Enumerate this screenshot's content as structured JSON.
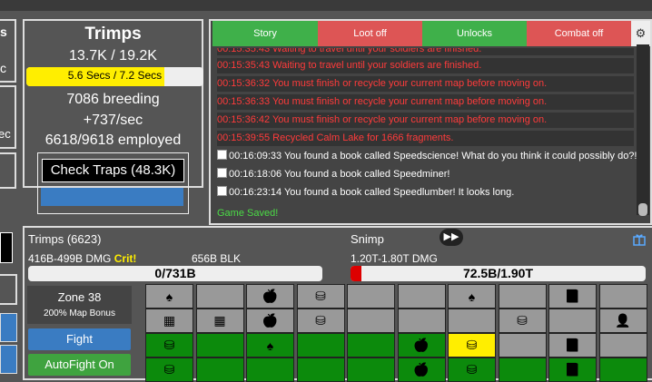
{
  "left_partial": {
    "text1": "s",
    "text2": "c",
    "text3": "ec"
  },
  "trimps_panel": {
    "title": "Trimps",
    "population": "13.7K / 19.2K",
    "breed_timer": "5.6 Secs / 7.2 Secs",
    "breed_progress": 0.78,
    "breeding": "7086 breeding",
    "rate": "+737/sec",
    "employed": "6618/9618 employed",
    "check_traps": "Check Traps (48.3K)"
  },
  "log": {
    "tabs": [
      {
        "label": "Story",
        "color": "#3fb04a"
      },
      {
        "label": "Loot off",
        "color": "#dd5555"
      },
      {
        "label": "Unlocks",
        "color": "#3fb04a"
      },
      {
        "label": "Combat off",
        "color": "#dd5555"
      }
    ],
    "lines": [
      {
        "text": "00:15:35:43 Waiting to travel until your soldiers are finished.",
        "style": "red",
        "clipped": true
      },
      {
        "text": "00:15:35:43 Waiting to travel until your soldiers are finished.",
        "style": "red"
      },
      {
        "text": "00:15:36:32 You must finish or recycle your current map before moving on.",
        "style": "red"
      },
      {
        "text": "00:15:36:33 You must finish or recycle your current map before moving on.",
        "style": "red"
      },
      {
        "text": "00:15:36:42 You must finish or recycle your current map before moving on.",
        "style": "red"
      },
      {
        "text": "00:15:39:55 Recycled Calm Lake for 1666 fragments.",
        "style": "red"
      },
      {
        "text": "00:16:09:33 You found a book called Speedscience! What do you think it could possibly do?!",
        "style": "white"
      },
      {
        "text": "00:16:18:06 You found a book called Speedminer!",
        "style": "white"
      },
      {
        "text": "00:16:23:14 You found a book called Speedlumber! It looks long.",
        "style": "white"
      },
      {
        "text": "Game Saved!",
        "style": "green"
      }
    ]
  },
  "battle": {
    "trimps_label": "Trimps (6623)",
    "dmg": "416B-499B DMG",
    "crit": "Crit!",
    "blk": "656B BLK",
    "trimp_hp": "0/731B",
    "trimp_hp_fraction": 0.0,
    "enemy_label": "Snimp",
    "enemy_dmg": "1.20T-1.80T DMG",
    "enemy_hp": "72.5B/1.90T",
    "enemy_hp_fraction": 0.038
  },
  "zone": {
    "name": "Zone 38",
    "bonus": "200% Map Bonus",
    "fight": "Fight",
    "autofight": "AutoFight On"
  },
  "grid": {
    "rows": [
      [
        "spade",
        "",
        "apple",
        "coins",
        "",
        "",
        "spade",
        "",
        "book"
      ],
      [
        "grid",
        "grid",
        "apple",
        "coins",
        "",
        "",
        "",
        "coins",
        "",
        "person"
      ],
      [
        "coins",
        "",
        "spade",
        "",
        "",
        "apple",
        "coins",
        "",
        "book"
      ],
      [
        "coins",
        "",
        "",
        "",
        "",
        "apple",
        "coins",
        "",
        "book"
      ]
    ],
    "row_colors": [
      [
        "gray",
        "gray",
        "gray",
        "gray",
        "gray",
        "gray",
        "gray",
        "gray",
        "gray",
        "gray"
      ],
      [
        "gray",
        "gray",
        "gray",
        "gray",
        "gray",
        "gray",
        "gray",
        "gray",
        "gray",
        "gray"
      ],
      [
        "green",
        "green",
        "green",
        "green",
        "green",
        "green",
        "yellow",
        "gray",
        "gray",
        "gray"
      ],
      [
        "green",
        "green",
        "green",
        "green",
        "green",
        "green",
        "green",
        "green",
        "green",
        "green"
      ]
    ]
  },
  "icons": {
    "spade": "♠",
    "apple": "🍎",
    "coins": "⛁",
    "book": "📕",
    "person": "👤",
    "grid": "▦"
  }
}
